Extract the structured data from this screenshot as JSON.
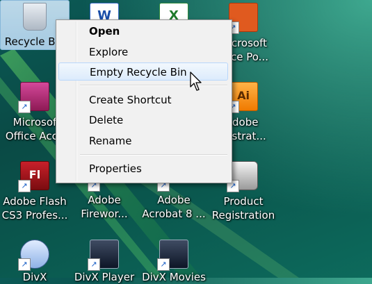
{
  "desktop_icons": [
    {
      "label1": "Recycle Bin",
      "label2": ""
    },
    {
      "label1": "",
      "label2": ""
    },
    {
      "label1": "",
      "label2": ""
    },
    {
      "label1": "icrosoft",
      "label2": "ffice Po..."
    },
    {
      "label1": "Microsof",
      "label2": "Office Acce"
    },
    {
      "label1": "Adobe",
      "label2": "ustrat..."
    },
    {
      "label1": "Adobe Flash",
      "label2": "CS3 Profes..."
    },
    {
      "label1": "Adobe",
      "label2": "Firewor..."
    },
    {
      "label1": "Adobe",
      "label2": "Acrobat 8 ..."
    },
    {
      "label1": "Product",
      "label2": "Registration"
    },
    {
      "label1": "DivX",
      "label2": ""
    },
    {
      "label1": "DivX Player",
      "label2": ""
    },
    {
      "label1": "DivX Movies",
      "label2": ""
    }
  ],
  "context_menu": {
    "open": "Open",
    "explore": "Explore",
    "empty_recycle_bin": "Empty Recycle Bin",
    "create_shortcut": "Create Shortcut",
    "delete": "Delete",
    "rename": "Rename",
    "properties": "Properties"
  },
  "icon_badges": {
    "word": "W",
    "excel": "X",
    "ai": "Ai",
    "fl": "Fl"
  }
}
